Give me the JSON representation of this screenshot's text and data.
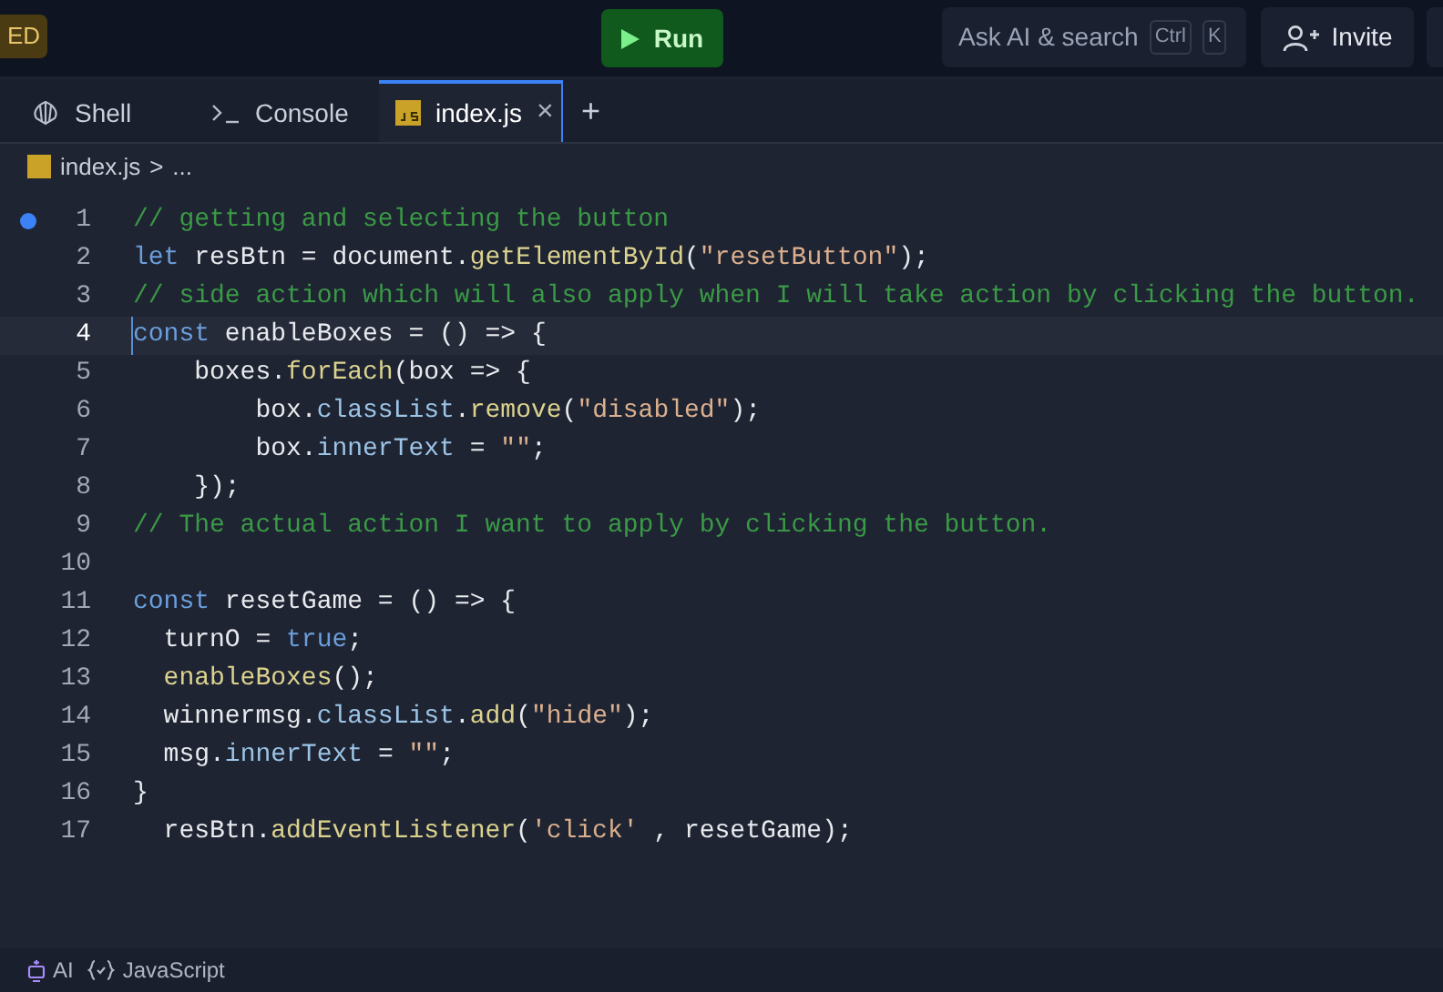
{
  "header": {
    "badge": "ED",
    "run_button": "Run",
    "search": {
      "placeholder": "Ask AI & search",
      "keys": [
        "Ctrl",
        "K"
      ]
    },
    "invite_button": "Invite"
  },
  "tabs": [
    {
      "label": "Shell",
      "kind": "shell",
      "selected": false
    },
    {
      "label": "Console",
      "kind": "console",
      "selected": false
    },
    {
      "label": "index.js",
      "kind": "file",
      "selected": true,
      "close": "×"
    }
  ],
  "new_tab": "+",
  "breadcrumb": {
    "file": "index.js",
    "separator": ">",
    "rest": "..."
  },
  "lines": [
    {
      "number": "1",
      "breakpoint": true,
      "current": false,
      "tokens": [
        {
          "text": "// getting and selecting the button",
          "kind": "comment"
        }
      ]
    },
    {
      "number": "2",
      "breakpoint": false,
      "current": false,
      "tokens": [
        {
          "text": "let",
          "kind": "keyword"
        },
        {
          "text": " resBtn = document.",
          "kind": "plain"
        },
        {
          "text": "getElementById",
          "kind": "function"
        },
        {
          "text": "(",
          "kind": "plain"
        },
        {
          "text": "\"resetButton\"",
          "kind": "string"
        },
        {
          "text": ");",
          "kind": "plain"
        }
      ]
    },
    {
      "number": "3",
      "breakpoint": false,
      "current": false,
      "tokens": [
        {
          "text": "// side action which will also apply when I will take action by clicking the button.",
          "kind": "comment"
        }
      ]
    },
    {
      "number": "4",
      "breakpoint": false,
      "current": true,
      "tokens": [
        {
          "text": "const",
          "kind": "keyword"
        },
        {
          "text": " enableBoxes = () => {",
          "kind": "plain"
        }
      ]
    },
    {
      "number": "5",
      "breakpoint": false,
      "current": false,
      "tokens": [
        {
          "text": "    boxes.",
          "kind": "plain"
        },
        {
          "text": "forEach",
          "kind": "function"
        },
        {
          "text": "(box => {",
          "kind": "plain"
        }
      ]
    },
    {
      "number": "6",
      "breakpoint": false,
      "current": false,
      "tokens": [
        {
          "text": "        box.",
          "kind": "plain"
        },
        {
          "text": "classList",
          "kind": "property"
        },
        {
          "text": ".",
          "kind": "plain"
        },
        {
          "text": "remove",
          "kind": "function"
        },
        {
          "text": "(",
          "kind": "plain"
        },
        {
          "text": "\"disabled\"",
          "kind": "string"
        },
        {
          "text": ");",
          "kind": "plain"
        }
      ]
    },
    {
      "number": "7",
      "breakpoint": false,
      "current": false,
      "tokens": [
        {
          "text": "        box.",
          "kind": "plain"
        },
        {
          "text": "innerText",
          "kind": "property"
        },
        {
          "text": " = ",
          "kind": "plain"
        },
        {
          "text": "\"\"",
          "kind": "string"
        },
        {
          "text": ";",
          "kind": "plain"
        }
      ]
    },
    {
      "number": "8",
      "breakpoint": false,
      "current": false,
      "tokens": [
        {
          "text": "    });",
          "kind": "plain"
        }
      ]
    },
    {
      "number": "9",
      "breakpoint": false,
      "current": false,
      "tokens": [
        {
          "text": "// The actual action I want to apply by clicking the button.",
          "kind": "comment"
        }
      ]
    },
    {
      "number": "10",
      "breakpoint": false,
      "current": false
    },
    {
      "number": "11",
      "breakpoint": false,
      "current": false,
      "tokens": [
        {
          "text": "const",
          "kind": "keyword"
        },
        {
          "text": " resetGame = () => {",
          "kind": "plain"
        }
      ]
    },
    {
      "number": "12",
      "breakpoint": false,
      "current": false,
      "tokens": [
        {
          "text": "  turnO = ",
          "kind": "plain"
        },
        {
          "text": "true",
          "kind": "keyword"
        },
        {
          "text": ";",
          "kind": "plain"
        }
      ]
    },
    {
      "number": "13",
      "breakpoint": false,
      "current": false,
      "tokens": [
        {
          "text": "  enableBoxes",
          "kind": "function"
        },
        {
          "text": "();",
          "kind": "plain"
        }
      ]
    },
    {
      "number": "14",
      "breakpoint": false,
      "current": false,
      "tokens": [
        {
          "text": "  winnermsg.",
          "kind": "plain"
        },
        {
          "text": "classList",
          "kind": "property"
        },
        {
          "text": ".",
          "kind": "plain"
        },
        {
          "text": "add",
          "kind": "function"
        },
        {
          "text": "(",
          "kind": "plain"
        },
        {
          "text": "\"hide\"",
          "kind": "string"
        },
        {
          "text": ");",
          "kind": "plain"
        }
      ]
    },
    {
      "number": "15",
      "breakpoint": false,
      "current": false,
      "tokens": [
        {
          "text": "  msg.",
          "kind": "plain"
        },
        {
          "text": "innerText",
          "kind": "property"
        },
        {
          "text": " = ",
          "kind": "plain"
        },
        {
          "text": "\"\"",
          "kind": "string"
        },
        {
          "text": ";",
          "kind": "plain"
        }
      ]
    },
    {
      "number": "16",
      "breakpoint": false,
      "current": false,
      "tokens": [
        {
          "text": "}",
          "kind": "plain"
        }
      ]
    },
    {
      "number": "17",
      "breakpoint": false,
      "current": false,
      "tokens": [
        {
          "text": "  resBtn.",
          "kind": "plain"
        },
        {
          "text": "addEventListener",
          "kind": "function"
        },
        {
          "text": "(",
          "kind": "plain"
        },
        {
          "text": "'click'",
          "kind": "string"
        },
        {
          "text": " , resetGame);",
          "kind": "plain"
        }
      ]
    }
  ],
  "status_bar": {
    "ai": "AI",
    "language": "JavaScript"
  }
}
